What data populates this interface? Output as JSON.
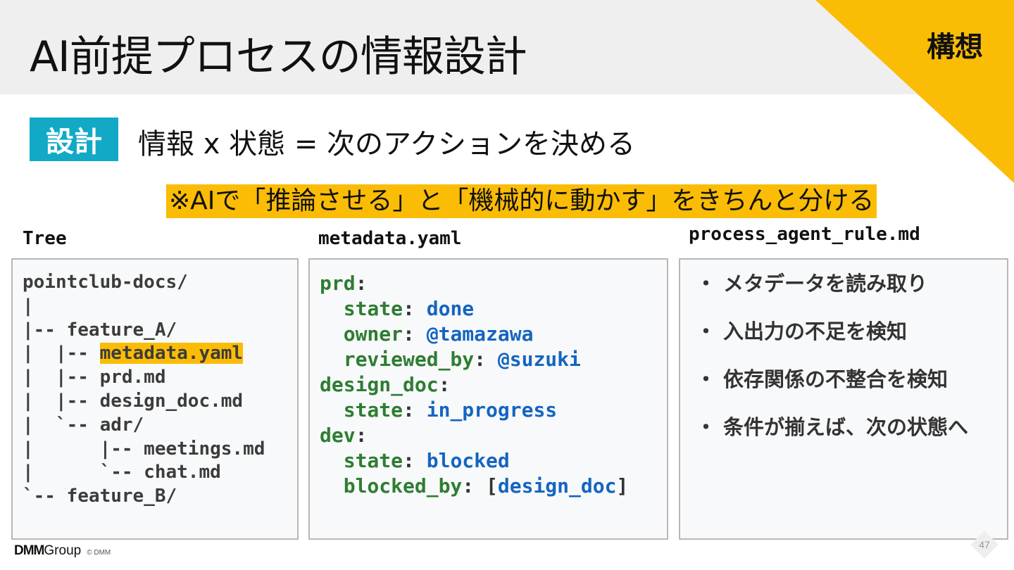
{
  "header": {
    "title": "AI前提プロセスの情報設計",
    "corner_label": "構想"
  },
  "design": {
    "badge": "設計",
    "subtitle": "情報 x 状態 = 次のアクションを決める"
  },
  "callout": "※AIで「推論させる」と「機械的に動かす」をきちんと分ける",
  "panels": {
    "tree": {
      "label": "Tree",
      "lines": [
        "pointclub-docs/",
        "|",
        "|-- feature_A/",
        "|  |-- ",
        "|  |-- prd.md",
        "|  |-- design_doc.md",
        "|  `-- adr/",
        "|      |-- meetings.md",
        "|      `-- chat.md",
        "`-- feature_B/"
      ],
      "highlight": "metadata.yaml"
    },
    "metadata": {
      "label": "metadata.yaml",
      "prd_key": "prd",
      "prd_state_key": "state",
      "prd_state": "done",
      "prd_owner_key": "owner",
      "prd_owner": "@tamazawa",
      "prd_reviewed_key": "reviewed_by",
      "prd_reviewed": "@suzuki",
      "design_key": "design_doc",
      "design_state_key": "state",
      "design_state": "in_progress",
      "dev_key": "dev",
      "dev_state_key": "state",
      "dev_state": "blocked",
      "dev_blocked_key": "blocked_by",
      "dev_blocked": "design_doc"
    },
    "rules": {
      "label": "process_agent_rule.md",
      "bullet": "・",
      "items": [
        "メタデータを読み取り",
        "入出力の不足を検知",
        "依存関係の不整合を検知",
        "条件が揃えば、次の状態へ"
      ]
    }
  },
  "footer": {
    "logo_dmm": "DMM",
    "logo_group": "Group",
    "copyright": "© DMM",
    "page_number": "47"
  },
  "colors": {
    "accent_yellow": "#fbbc05",
    "badge_cyan": "#12a9c7",
    "yaml_key": "#2e7d32",
    "yaml_value": "#1565c0"
  }
}
